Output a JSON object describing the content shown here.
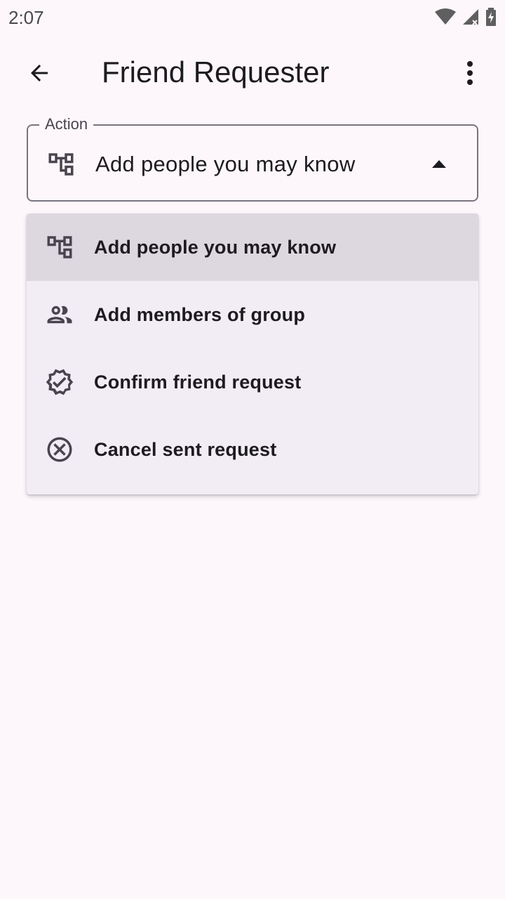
{
  "status_bar": {
    "time": "2:07",
    "icons": [
      "wifi-icon",
      "cell-signal-icon",
      "battery-charging-icon"
    ]
  },
  "app_bar": {
    "title": "Friend Requester",
    "back_icon": "arrow-back-icon",
    "menu_icon": "more-vert-icon"
  },
  "action_field": {
    "label": "Action",
    "value": "Add people you may know",
    "icon": "account-tree-icon",
    "state": "expanded"
  },
  "menu": {
    "items": [
      {
        "label": "Add people you may know",
        "icon": "account-tree-icon",
        "selected": true
      },
      {
        "label": "Add members of group",
        "icon": "group-icon",
        "selected": false
      },
      {
        "label": "Confirm friend request",
        "icon": "verified-badge-icon",
        "selected": false
      },
      {
        "label": "Cancel sent request",
        "icon": "cancel-circle-icon",
        "selected": false
      }
    ]
  },
  "colors": {
    "background": "#fdf7fb",
    "menu_background": "#f2ecf5",
    "selected_item": "#ddd7e0",
    "outline": "#79747e",
    "text": "#1d1b20"
  }
}
